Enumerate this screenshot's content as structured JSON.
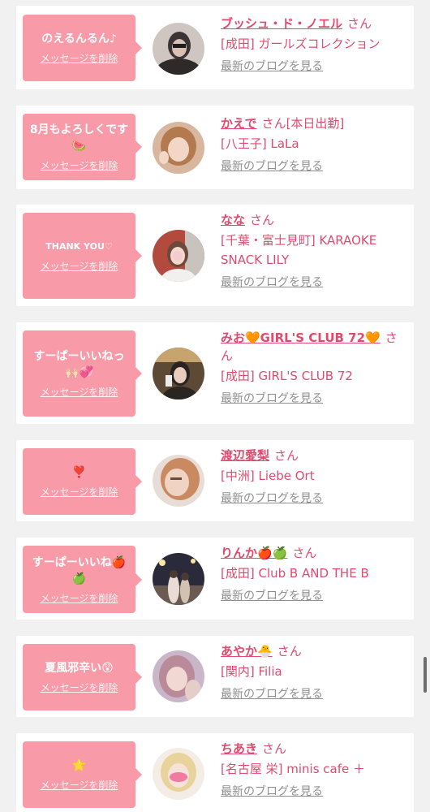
{
  "theme": {
    "bubble_color": "#f99aa8",
    "name_color": "#e14a6e",
    "link_gray": "#8f8f8f"
  },
  "san_label": "さん",
  "delete_label": "メッセージを削除",
  "blog_label": "最新のブログを見る",
  "items": [
    {
      "message": "のえるんるん♪",
      "name": "ブッシュ・ド・ノエル",
      "status": "",
      "shop": "[成田] ガールズコレクション"
    },
    {
      "message": "8月もよろしくです🍉",
      "name": "かえで",
      "status": "[本日出勤]",
      "shop": "[八王子] LaLa"
    },
    {
      "message": "THANK YOU♡",
      "name": "なな",
      "status": "",
      "shop": "[千葉・富士見町] KARAOKE SNACK LILY"
    },
    {
      "message": "すーぱーいいねっ🙌🏻💞",
      "name": "みお🧡GIRL'S CLUB 72🧡",
      "status": "",
      "shop": "[成田] GIRL'S CLUB 72"
    },
    {
      "message": "❣️",
      "name": "渡辺愛梨",
      "status": "",
      "shop": "[中洲] Liebe Ort"
    },
    {
      "message": "すーぱーいいね🍎🍏",
      "name": "りんか🍎🍏",
      "status": "",
      "shop": "[成田] Club B AND THE B"
    },
    {
      "message": "夏風邪辛い😲",
      "name": "あやか🐣",
      "status": "",
      "shop": "[関内] Filia"
    },
    {
      "message": "🌟",
      "name": "ちあき",
      "status": "",
      "shop": "[名古屋 栄] minis cafe ＋"
    }
  ]
}
